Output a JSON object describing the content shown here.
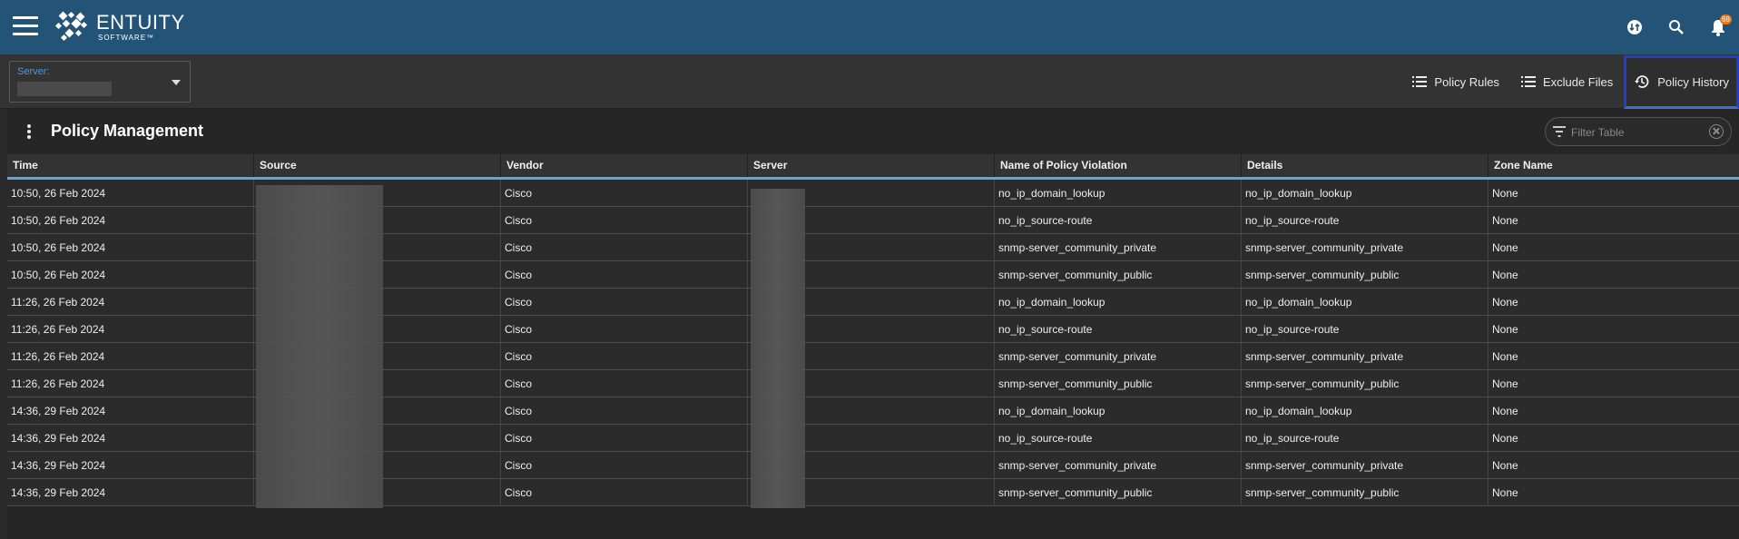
{
  "header": {
    "logo_name": "ENTUITY",
    "logo_sub": "SOFTWARE™",
    "notification_count": "69",
    "brand_color": "#235478"
  },
  "server": {
    "label": "Server:",
    "value": ""
  },
  "nav": {
    "policy_rules": "Policy Rules",
    "exclude_files": "Exclude Files",
    "policy_history": "Policy History"
  },
  "panel": {
    "title": "Policy Management",
    "filter_placeholder": "Filter Table"
  },
  "table": {
    "columns": [
      "Time",
      "Source",
      "Vendor",
      "Server",
      "Name of Policy Violation",
      "Details",
      "Zone Name"
    ],
    "rows": [
      [
        "10:50, 26 Feb 2024",
        "",
        "Cisco",
        "",
        "no_ip_domain_lookup",
        "no_ip_domain_lookup",
        "None"
      ],
      [
        "10:50, 26 Feb 2024",
        "",
        "Cisco",
        "",
        "no_ip_source-route",
        "no_ip_source-route",
        "None"
      ],
      [
        "10:50, 26 Feb 2024",
        "",
        "Cisco",
        "",
        "snmp-server_community_private",
        "snmp-server_community_private",
        "None"
      ],
      [
        "10:50, 26 Feb 2024",
        "",
        "Cisco",
        "",
        "snmp-server_community_public",
        "snmp-server_community_public",
        "None"
      ],
      [
        "11:26, 26 Feb 2024",
        "",
        "Cisco",
        "",
        "no_ip_domain_lookup",
        "no_ip_domain_lookup",
        "None"
      ],
      [
        "11:26, 26 Feb 2024",
        "",
        "Cisco",
        "",
        "no_ip_source-route",
        "no_ip_source-route",
        "None"
      ],
      [
        "11:26, 26 Feb 2024",
        "",
        "Cisco",
        "",
        "snmp-server_community_private",
        "snmp-server_community_private",
        "None"
      ],
      [
        "11:26, 26 Feb 2024",
        "",
        "Cisco",
        "",
        "snmp-server_community_public",
        "snmp-server_community_public",
        "None"
      ],
      [
        "14:36, 29 Feb 2024",
        "",
        "Cisco",
        "",
        "no_ip_domain_lookup",
        "no_ip_domain_lookup",
        "None"
      ],
      [
        "14:36, 29 Feb 2024",
        "",
        "Cisco",
        "",
        "no_ip_source-route",
        "no_ip_source-route",
        "None"
      ],
      [
        "14:36, 29 Feb 2024",
        "",
        "Cisco",
        "",
        "snmp-server_community_private",
        "snmp-server_community_private",
        "None"
      ],
      [
        "14:36, 29 Feb 2024",
        "",
        "Cisco",
        "",
        "snmp-server_community_public",
        "snmp-server_community_public",
        "None"
      ]
    ]
  }
}
